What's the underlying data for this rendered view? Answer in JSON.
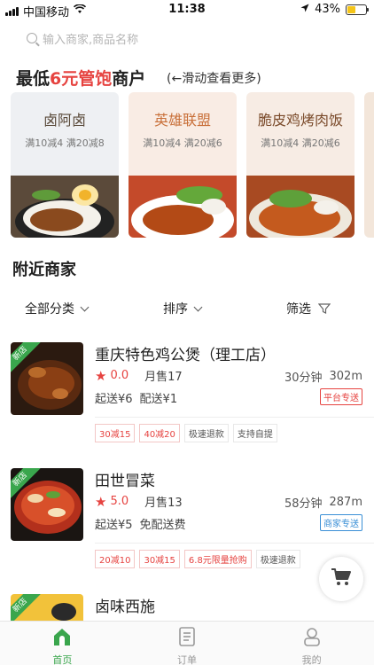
{
  "status_bar": {
    "carrier": "中国移动",
    "time": "11:38",
    "battery": "43%",
    "battery_level": 0.43
  },
  "search": {
    "placeholder": "输入商家,商品名称"
  },
  "promo": {
    "title_prefix": "最低",
    "title_highlight": "6元管饱",
    "title_suffix": "商户",
    "hint": "(←滑动查看更多)",
    "cards": [
      {
        "name": "卤阿卤",
        "discount": "满10减4 满20减8",
        "bg": "#eef0f3",
        "name_color": "#5a4a3a"
      },
      {
        "name": "英雄联盟",
        "discount": "满10减4 满20减6",
        "bg": "#f9ece4",
        "name_color": "#c9703a"
      },
      {
        "name": "脆皮鸡烤肉饭",
        "discount": "满10减4 满20减6",
        "bg": "#f7ece4",
        "name_color": "#7a4a2a"
      }
    ]
  },
  "nearby": {
    "title": "附近商家",
    "filters": {
      "category": "全部分类",
      "sort": "排序",
      "filter": "筛选"
    }
  },
  "merchants": [
    {
      "name": "重庆特色鸡公煲（理工店）",
      "badge": "新店",
      "score": "0.0",
      "monthly_sales": "月售17",
      "time": "30分钟",
      "distance": "302m",
      "min_order": "起送¥6",
      "delivery_fee": "配送¥1",
      "delivery_type": "平台专送",
      "delivery_color": "#e64340",
      "tags": [
        {
          "text": "30减15",
          "style": "red"
        },
        {
          "text": "40减20",
          "style": "red"
        },
        {
          "text": "极速退款",
          "style": "normal"
        },
        {
          "text": "支持自提",
          "style": "normal"
        }
      ]
    },
    {
      "name": "田世冒菜",
      "badge": "新店",
      "score": "5.0",
      "monthly_sales": "月售13",
      "time": "58分钟",
      "distance": "287m",
      "min_order": "起送¥5",
      "delivery_fee": "免配送费",
      "delivery_type": "商家专送",
      "delivery_color": "#3a8fd6",
      "tags": [
        {
          "text": "20减10",
          "style": "red"
        },
        {
          "text": "30减15",
          "style": "red"
        },
        {
          "text": "6.8元限量抢购",
          "style": "red"
        },
        {
          "text": "极速退款",
          "style": "normal"
        }
      ]
    },
    {
      "name": "卤味西施",
      "badge": "新店"
    }
  ],
  "tabbar": {
    "items": [
      {
        "label": "首页",
        "icon": "home-icon",
        "active": true
      },
      {
        "label": "订单",
        "icon": "order-icon",
        "active": false
      },
      {
        "label": "我的",
        "icon": "profile-icon",
        "active": false
      }
    ],
    "active_color": "#3aa64d"
  }
}
